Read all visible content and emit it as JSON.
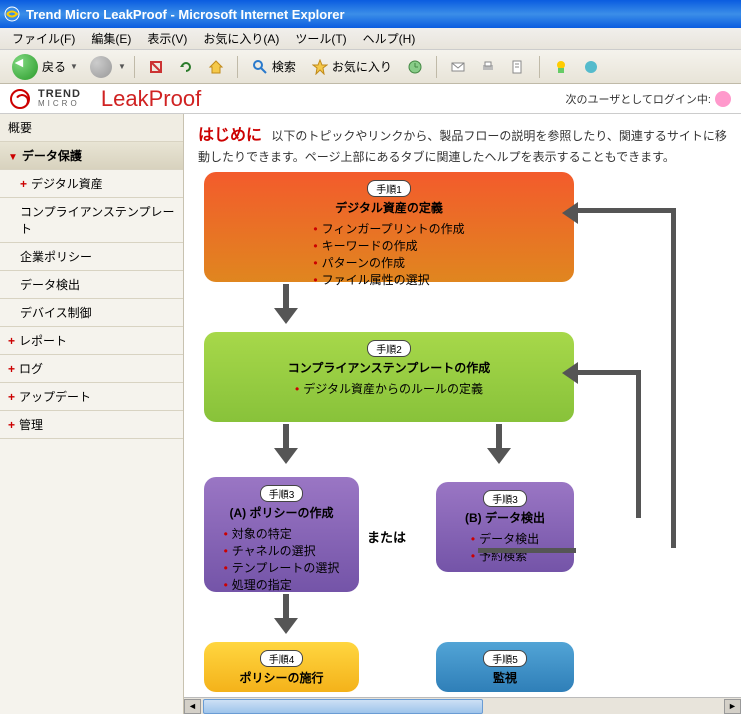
{
  "window": {
    "title": "Trend Micro LeakProof - Microsoft Internet Explorer"
  },
  "menubar": {
    "file": "ファイル(F)",
    "edit": "編集(E)",
    "view": "表示(V)",
    "favorites": "お気に入り(A)",
    "tools": "ツール(T)",
    "help": "ヘルプ(H)"
  },
  "toolbar": {
    "back": "戻る",
    "search": "検索",
    "favorites": "お気に入り"
  },
  "brand": {
    "trend": "TREND",
    "micro": "MICRO",
    "product": "LeakProof"
  },
  "login": {
    "label": "次のユーザとしてログイン中:"
  },
  "sidebar": {
    "overview": "概要",
    "dataprotect": "データ保護",
    "digitalasset": "デジタル資産",
    "compliancetpl": "コンプライアンステンプレート",
    "policy": "企業ポリシー",
    "datadiscovery": "データ検出",
    "devicectrl": "デバイス制御",
    "report": "レポート",
    "log": "ログ",
    "update": "アップデート",
    "admin": "管理"
  },
  "intro": {
    "heading": "はじめに",
    "text": "以下のトピックやリンクから、製品フローの説明を参照したり、関連するサイトに移動したりできます。ページ上部にあるタブに関連したヘルプを表示することもできます。"
  },
  "flow": {
    "step1": {
      "step": "手順1",
      "title": "デジタル資産の定義",
      "i1": "フィンガープリントの作成",
      "i2": "キーワードの作成",
      "i3": "パターンの作成",
      "i4": "ファイル属性の選択"
    },
    "step2": {
      "step": "手順2",
      "title": "コンプライアンステンプレートの作成",
      "i1": "デジタル資産からのルールの定義"
    },
    "or": "または",
    "step3a": {
      "step": "手順3",
      "title": "(A) ポリシーの作成",
      "i1": "対象の特定",
      "i2": "チャネルの選択",
      "i3": "テンプレートの選択",
      "i4": "処理の指定"
    },
    "step3b": {
      "step": "手順3",
      "title": "(B) データ検出",
      "i1": "データ検出",
      "i2": "予約検索"
    },
    "step4": {
      "step": "手順4",
      "title": "ポリシーの施行"
    },
    "step5": {
      "step": "手順5",
      "title": "監視"
    }
  }
}
